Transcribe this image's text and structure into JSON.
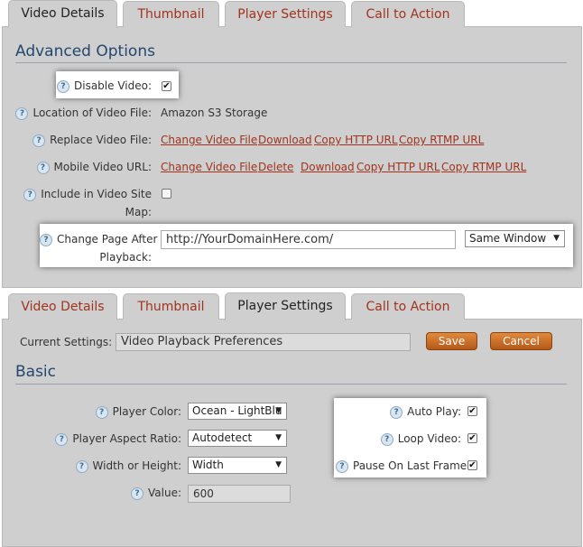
{
  "top": {
    "tabs": [
      "Video Details",
      "Thumbnail",
      "Player Settings",
      "Call to Action"
    ],
    "active_tab": "Video Details",
    "section_title": "Advanced Options",
    "disable_video": {
      "label": "Disable Video:",
      "checked": true
    },
    "location": {
      "label": "Location of Video File:",
      "value": "Amazon S3 Storage"
    },
    "replace": {
      "label": "Replace Video File:",
      "links": [
        "Change Video File",
        "Download",
        "Copy HTTP URL",
        "Copy RTMP URL"
      ]
    },
    "mobile": {
      "label": "Mobile Video URL:",
      "links": [
        "Change Video File",
        "Delete",
        "Download",
        "Copy HTTP URL",
        "Copy RTMP URL"
      ]
    },
    "sitemap": {
      "label_line1": "Include in Video Site",
      "label_line2": "Map:",
      "checked": false
    },
    "change_page": {
      "label_line1": "Change Page After",
      "label_line2": "Playback:",
      "url": "http://YourDomainHere.com/",
      "window": "Same Window"
    }
  },
  "bottom": {
    "tabs": [
      "Video Details",
      "Thumbnail",
      "Player Settings",
      "Call to Action"
    ],
    "active_tab": "Player Settings",
    "current_settings": {
      "label": "Current Settings:",
      "value": "Video Playback Preferences"
    },
    "save_label": "Save",
    "cancel_label": "Cancel",
    "section_title": "Basic",
    "player_color": {
      "label": "Player Color:",
      "value": "Ocean - LightBlu"
    },
    "aspect_ratio": {
      "label": "Player Aspect Ratio:",
      "value": "Autodetect"
    },
    "width_height": {
      "label": "Width or Height:",
      "value": "Width"
    },
    "value_field": {
      "label": "Value:",
      "value": "600"
    },
    "auto_play": {
      "label": "Auto Play:",
      "checked": true
    },
    "loop_video": {
      "label": "Loop Video:",
      "checked": true
    },
    "pause_last": {
      "label": "Pause On Last Frame:",
      "checked": true
    }
  },
  "icons": {
    "help": "help-question-icon",
    "check": "check-mark-icon",
    "dropdown": "chevron-down-icon"
  },
  "colors": {
    "link": "#a1331d",
    "heading": "#24476f",
    "panel": "#cfcfcf",
    "button": "#c96c28"
  }
}
